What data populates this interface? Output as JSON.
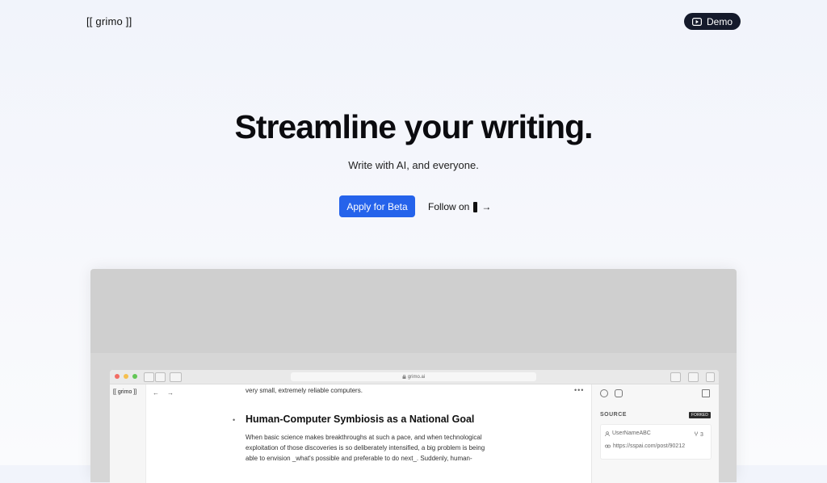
{
  "header": {
    "logo": "[[ grimo ]]",
    "demo_label": "Demo"
  },
  "hero": {
    "title": "Streamline your writing.",
    "subtitle": "Write with AI, and everyone.",
    "apply_label": "Apply for Beta",
    "follow_label": "Follow on",
    "follow_arrow": "→"
  },
  "preview": {
    "address": "grimo.ai",
    "app_logo": "[[ grimo ]]",
    "nav_back": "←",
    "nav_forward": "→",
    "more": "•••",
    "top_text": "very small, extremely reliable computers.",
    "heading": "Human-Computer Symbiosis as a National Goal",
    "bullet": "•",
    "paragraph_lines": [
      "When basic science makes breakthroughs at such a pace, and when technological",
      "exploitation of those discoveries is so deliberately intensified, a big problem is being",
      "able to envision _what's possible and preferable to do next_. Suddenly, human-"
    ],
    "panel": {
      "source_label": "SOURCE",
      "forked_badge": "FORKED",
      "username": "UserNameABC",
      "fork_count": "3",
      "url": "https://sspai.com/post/90212"
    }
  },
  "colors": {
    "primary": "#2563eb",
    "dark": "#151a2b"
  }
}
